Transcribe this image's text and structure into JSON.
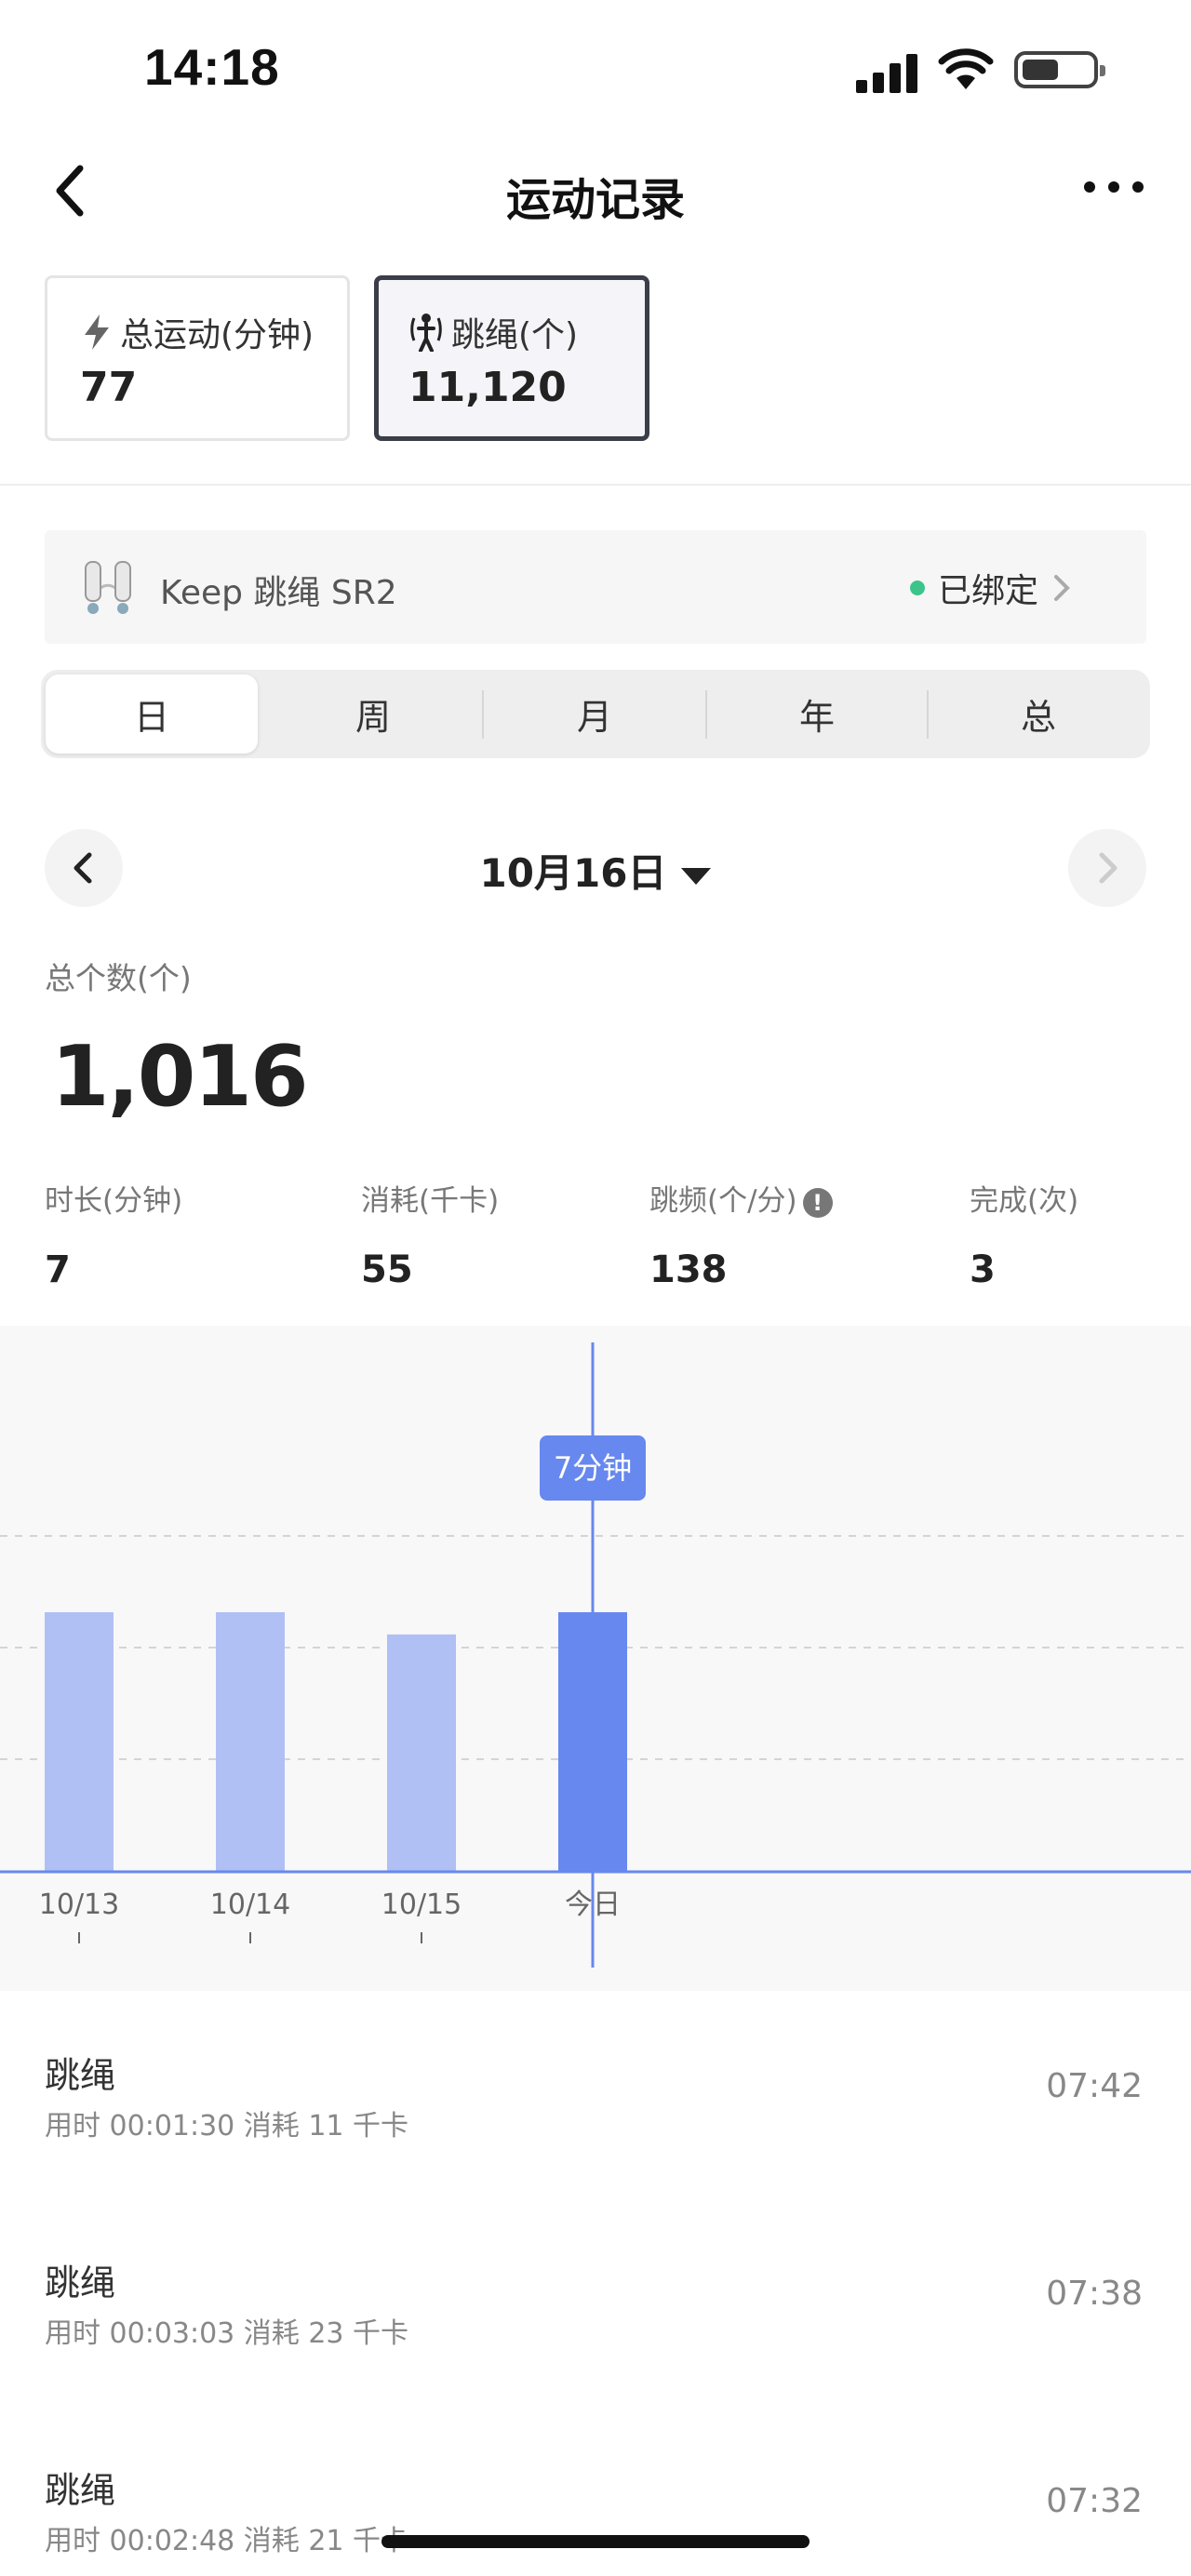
{
  "status_bar": {
    "time": "14:18"
  },
  "nav": {
    "title": "运动记录"
  },
  "summary_cards": [
    {
      "label": "总运动(分钟)",
      "value": "77",
      "icon": "lightning-icon"
    },
    {
      "label": "跳绳(个)",
      "value": "11,120",
      "icon": "jump-rope-icon"
    }
  ],
  "device": {
    "name": "Keep 跳绳 SR2",
    "status": "已绑定",
    "status_color": "#3cc48a"
  },
  "tabs": [
    "日",
    "周",
    "月",
    "年",
    "总"
  ],
  "selected_tab": "日",
  "date": "10月16日",
  "total": {
    "label": "总个数(个)",
    "value": "1,016"
  },
  "stats": [
    {
      "label": "时长(分钟)",
      "value": "7"
    },
    {
      "label": "消耗(千卡)",
      "value": "55"
    },
    {
      "label": "跳频(个/分)",
      "value": "138"
    },
    {
      "label": "完成(次)",
      "value": "3"
    }
  ],
  "chart_data": {
    "type": "bar",
    "categories": [
      "10/13",
      "10/14",
      "10/15",
      "今日"
    ],
    "values": [
      7,
      7,
      6.4,
      7
    ],
    "highlight_index": 3,
    "tooltip": "7分钟",
    "ylim": [
      0,
      10
    ],
    "grid": true,
    "colors": {
      "bar": "#b0c0f4",
      "highlight": "#6788ee",
      "tooltip_bg": "#6788ee"
    }
  },
  "records": [
    {
      "title": "跳绳",
      "meta": "用时 00:01:30    消耗 11 千卡",
      "time": "07:42"
    },
    {
      "title": "跳绳",
      "meta": "用时 00:03:03    消耗 23 千卡",
      "time": "07:38"
    },
    {
      "title": "跳绳",
      "meta": "用时 00:02:48    消耗 21 千卡",
      "time": "07:32"
    }
  ]
}
